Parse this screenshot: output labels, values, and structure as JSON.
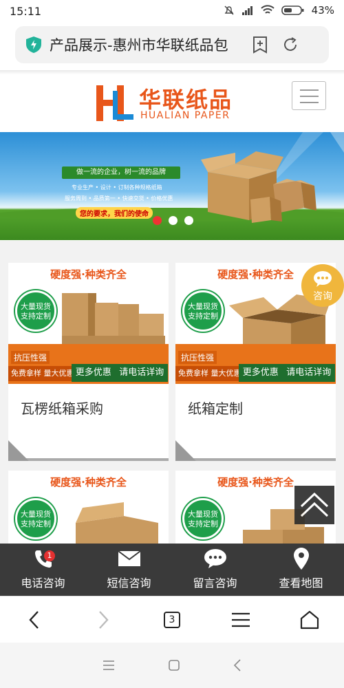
{
  "status": {
    "time": "15:11",
    "battery": "43%"
  },
  "browser": {
    "url_text": "产品展示-惠州市华联纸品包",
    "tab_count": "3"
  },
  "site": {
    "logo_cn": "华联纸品",
    "logo_en": "HUALIAN PAPER",
    "banner": {
      "headline": "做一流的企业，树一流的品牌",
      "line1": "专业生产 • 设计 • 订制各种规格纸箱",
      "line2": "服务周到 • 品质第一 • 快速交货 • 价格优惠",
      "slogan": "您的要求，我们的使命"
    }
  },
  "products": [
    {
      "promo_title": "硬度强·种类齐全",
      "badge_line1": "大量现货",
      "badge_line2": "支持定制",
      "tag1": "抗压性强",
      "tag2": "免费拿样 量大优惠",
      "tag3a": "更多优惠",
      "tag3b": "请电话详询",
      "name": "瓦楞纸箱采购"
    },
    {
      "promo_title": "硬度强·种类齐全",
      "badge_line1": "大量现货",
      "badge_line2": "支持定制",
      "tag1": "抗压性强",
      "tag2": "免费拿样 量大优惠",
      "tag3a": "更多优惠",
      "tag3b": "请电话详询",
      "name": "纸箱定制"
    },
    {
      "promo_title": "硬度强·种类齐全",
      "badge_line1": "大量现货",
      "badge_line2": "支持定制"
    },
    {
      "promo_title": "硬度强·种类齐全",
      "badge_line1": "大量现货",
      "badge_line2": "支持定制"
    }
  ],
  "consult_label": "咨询",
  "bottom_nav": [
    {
      "label": "电话咨询",
      "icon": "phone-icon",
      "badge": "1"
    },
    {
      "label": "短信咨询",
      "icon": "envelope-icon"
    },
    {
      "label": "留言咨询",
      "icon": "chat-bubble-icon"
    },
    {
      "label": "查看地图",
      "icon": "map-pin-icon"
    }
  ],
  "colors": {
    "brand_orange": "#e8561a",
    "badge_green": "#1e9e4a",
    "nav_dark": "#3a3a3a"
  }
}
